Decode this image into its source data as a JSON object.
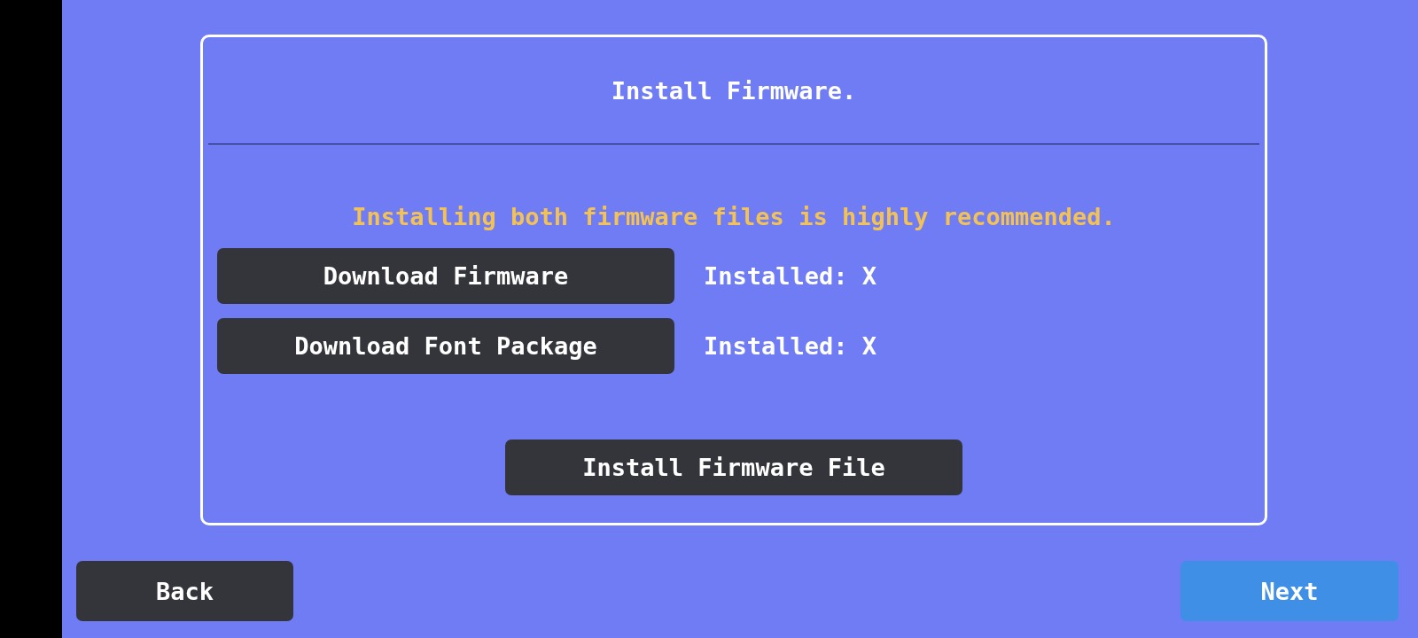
{
  "dialog": {
    "title": "Install Firmware.",
    "notice": "Installing both firmware files is highly recommended.",
    "downloads": [
      {
        "button": "Download Firmware",
        "status": "Installed: X"
      },
      {
        "button": "Download Font Package",
        "status": "Installed: X"
      }
    ],
    "install_button": "Install Firmware File"
  },
  "nav": {
    "back": "Back",
    "next": "Next"
  }
}
